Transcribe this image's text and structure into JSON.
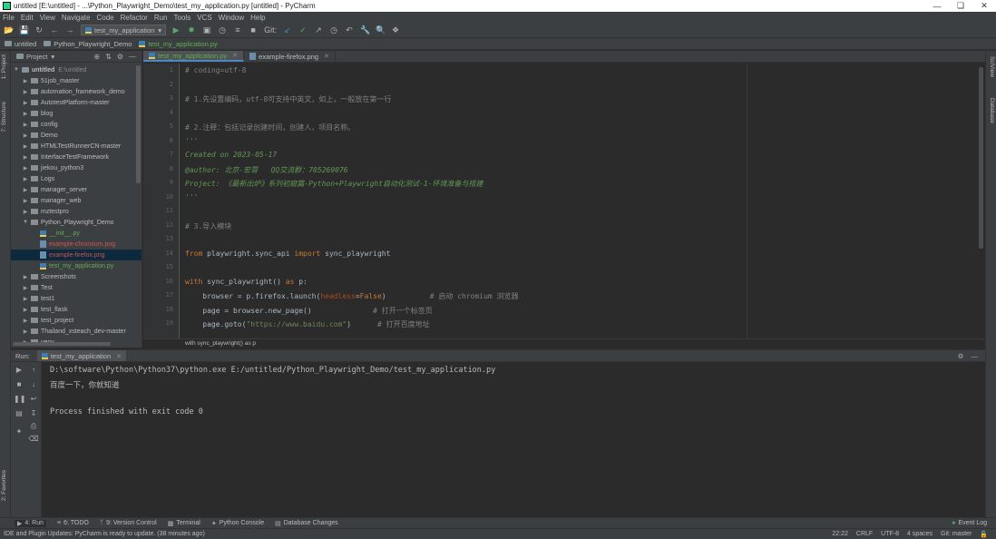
{
  "window": {
    "title": "untitled [E:\\untitled] - ...\\Python_Playwright_Demo\\test_my_application.py [untitled] - PyCharm"
  },
  "menu": [
    "File",
    "Edit",
    "View",
    "Navigate",
    "Code",
    "Refactor",
    "Run",
    "Tools",
    "VCS",
    "Window",
    "Help"
  ],
  "toolbar": {
    "run_config": "test_my_application",
    "git_label": "Git:"
  },
  "navbar": {
    "project": "untitled",
    "folder": "Python_Playwright_Demo",
    "file": "test_my_application.py"
  },
  "side_tabs": {
    "project": "1: Project",
    "structure": "7: Structure",
    "favorites": "2: Favorites",
    "scview": "SciView",
    "database": "Database"
  },
  "project_panel": {
    "title": "Project",
    "root": "untitled",
    "root_path": "E:\\untitled",
    "items": [
      {
        "label": "51job_master",
        "type": "folder",
        "depth": 1
      },
      {
        "label": "automation_framework_demo",
        "type": "folder",
        "depth": 1
      },
      {
        "label": "AutotestPlatform-master",
        "type": "folder",
        "depth": 1
      },
      {
        "label": "blog",
        "type": "folder",
        "depth": 1
      },
      {
        "label": "config",
        "type": "folder",
        "depth": 1
      },
      {
        "label": "Demo",
        "type": "folder",
        "depth": 1
      },
      {
        "label": "HTMLTestRunnerCN-master",
        "type": "folder",
        "depth": 1
      },
      {
        "label": "InterfaceTestFramework",
        "type": "folder",
        "depth": 1
      },
      {
        "label": "jiekou_python3",
        "type": "folder",
        "depth": 1
      },
      {
        "label": "Logs",
        "type": "folder",
        "depth": 1
      },
      {
        "label": "manager_server",
        "type": "folder",
        "depth": 1
      },
      {
        "label": "manager_web",
        "type": "folder",
        "depth": 1
      },
      {
        "label": "mztestpro",
        "type": "folder",
        "depth": 1
      },
      {
        "label": "Python_Playwright_Demo",
        "type": "folder-open",
        "depth": 1
      },
      {
        "label": "__init__.py",
        "type": "py",
        "depth": 2,
        "color": "green"
      },
      {
        "label": "example-chromium.png",
        "type": "png",
        "depth": 2,
        "color": "red"
      },
      {
        "label": "example-firefox.png",
        "type": "png",
        "depth": 2,
        "color": "red",
        "selected": true
      },
      {
        "label": "test_my_application.py",
        "type": "py",
        "depth": 2,
        "color": "green"
      },
      {
        "label": "Screenshots",
        "type": "folder",
        "depth": 1
      },
      {
        "label": "Test",
        "type": "folder",
        "depth": 1
      },
      {
        "label": "test1",
        "type": "folder",
        "depth": 1
      },
      {
        "label": "test_flask",
        "type": "folder",
        "depth": 1
      },
      {
        "label": "test_project",
        "type": "folder",
        "depth": 1
      },
      {
        "label": "Thailand_xsteach_dev-master",
        "type": "folder",
        "depth": 1
      },
      {
        "label": "venv",
        "type": "folder",
        "depth": 1
      }
    ]
  },
  "editor_tabs": [
    {
      "label": "test_my_application.py",
      "active": true
    },
    {
      "label": "example-firefox.png",
      "active": false
    }
  ],
  "code_lines": [
    {
      "n": "1",
      "segs": [
        {
          "t": "# coding=utf-8",
          "c": "c-comment"
        }
      ]
    },
    {
      "n": "2",
      "segs": []
    },
    {
      "n": "3",
      "segs": [
        {
          "t": "# 1.先设置编码，utf-8可支持中英文，如上，一般放在第一行",
          "c": "c-comment"
        }
      ]
    },
    {
      "n": "4",
      "segs": []
    },
    {
      "n": "5",
      "segs": [
        {
          "t": "# 2.注释：包括记录创建时间，创建人，项目名称。",
          "c": "c-comment"
        }
      ]
    },
    {
      "n": "6",
      "segs": [
        {
          "t": "'''",
          "c": "c-doc"
        }
      ]
    },
    {
      "n": "7",
      "segs": [
        {
          "t": "Created on 2023-05-17",
          "c": "c-doc"
        }
      ]
    },
    {
      "n": "8",
      "segs": [
        {
          "t": "@author: 北京-宏哥   QQ交流群：705269076",
          "c": "c-doc"
        }
      ]
    },
    {
      "n": "9",
      "segs": [
        {
          "t": "Project: 《最新出炉》系列初窥篇-Python+Playwright自动化测试-1-环境准备与搭建",
          "c": "c-doc"
        }
      ]
    },
    {
      "n": "10",
      "segs": [
        {
          "t": "'''",
          "c": "c-doc"
        }
      ]
    },
    {
      "n": "11",
      "segs": []
    },
    {
      "n": "12",
      "segs": [
        {
          "t": "# 3.导入模块",
          "c": "c-comment"
        }
      ]
    },
    {
      "n": "13",
      "segs": []
    },
    {
      "n": "14",
      "segs": [
        {
          "t": "from",
          "c": "c-kw"
        },
        {
          "t": " playwright.sync_api ",
          "c": ""
        },
        {
          "t": "import",
          "c": "c-kw"
        },
        {
          "t": " sync_playwright",
          "c": ""
        }
      ]
    },
    {
      "n": "15",
      "segs": []
    },
    {
      "n": "16",
      "segs": [
        {
          "t": "with",
          "c": "c-kw"
        },
        {
          "t": " sync_playwright() ",
          "c": ""
        },
        {
          "t": "as",
          "c": "c-kw"
        },
        {
          "t": " p:",
          "c": ""
        }
      ]
    },
    {
      "n": "17",
      "segs": [
        {
          "t": "    browser = p.firefox.launch(",
          "c": ""
        },
        {
          "t": "headless",
          "c": "c-param"
        },
        {
          "t": "=",
          "c": ""
        },
        {
          "t": "False",
          "c": "c-kw"
        },
        {
          "t": ")          ",
          "c": ""
        },
        {
          "t": "# 启动 chromium 浏览器",
          "c": "c-comment"
        }
      ]
    },
    {
      "n": "18",
      "segs": [
        {
          "t": "    page = browser.new_page()              ",
          "c": ""
        },
        {
          "t": "# 打开一个标签页",
          "c": "c-comment"
        }
      ]
    },
    {
      "n": "19",
      "segs": [
        {
          "t": "    page.goto(",
          "c": ""
        },
        {
          "t": "\"https://www.baidu.com\"",
          "c": "c-str"
        },
        {
          "t": ")      ",
          "c": ""
        },
        {
          "t": "# 打开百度地址",
          "c": "c-comment"
        }
      ]
    }
  ],
  "editor_breadcrumb": "with sync_playwright() as p",
  "run_panel": {
    "label": "Run:",
    "tab": "test_my_application",
    "lines": [
      "D:\\software\\Python\\Python37\\python.exe E:/untitled/Python_Playwright_Demo/test_my_application.py",
      "百度一下，你就知道",
      "",
      "Process finished with exit code 0"
    ]
  },
  "bottom_tabs": [
    {
      "label": "4: Run",
      "icon": "play-icon",
      "active": true
    },
    {
      "label": "6: TODO",
      "icon": "list-icon",
      "active": false
    },
    {
      "label": "9: Version Control",
      "icon": "vcs-icon",
      "active": false
    },
    {
      "label": "Terminal",
      "icon": "terminal-icon",
      "active": false
    },
    {
      "label": "Python Console",
      "icon": "python-icon",
      "active": false
    },
    {
      "label": "Database Changes",
      "icon": "database-icon",
      "active": false
    }
  ],
  "event_log": "Event Log",
  "status": {
    "message": "IDE and Plugin Updates: PyCharm is ready to update. (38 minutes ago)",
    "position": "22:22",
    "line_sep": "CRLF",
    "encoding": "UTF-8",
    "indent": "4 spaces",
    "git": "Git: master"
  }
}
